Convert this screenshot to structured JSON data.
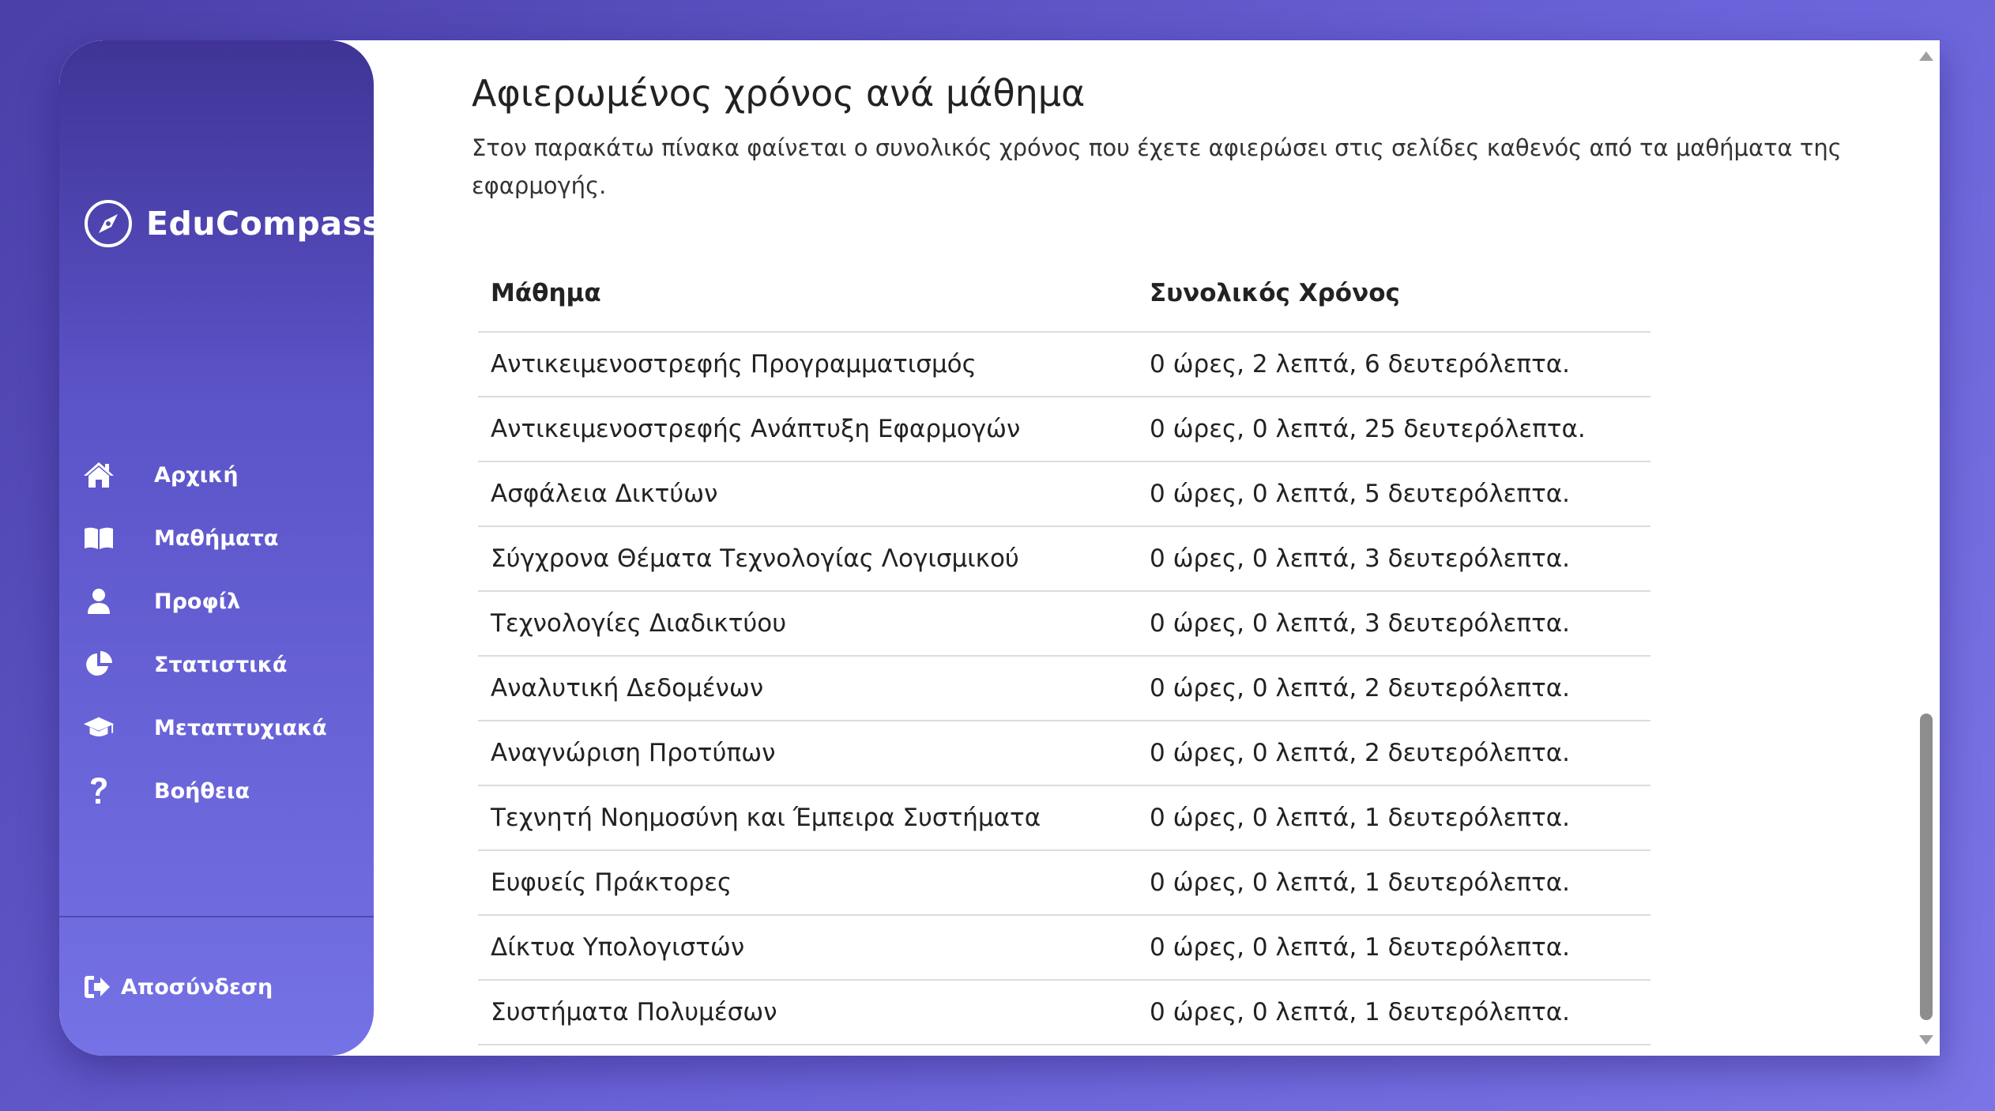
{
  "app": {
    "brand_name": "EduCompass",
    "logo_icon": "compass-icon"
  },
  "sidebar": {
    "items": [
      {
        "label": "Αρχική",
        "icon": "home-icon"
      },
      {
        "label": "Μαθήματα",
        "icon": "book-icon"
      },
      {
        "label": "Προφίλ",
        "icon": "user-icon"
      },
      {
        "label": "Στατιστικά",
        "icon": "pie-chart-icon"
      },
      {
        "label": "Μεταπτυχιακά",
        "icon": "graduation-cap-icon"
      },
      {
        "label": "Βοήθεια",
        "icon": "question-icon"
      }
    ],
    "logout": {
      "label": "Αποσύνδεση",
      "icon": "sign-out-icon"
    }
  },
  "main": {
    "title": "Αφιερωμένος χρόνος ανά μάθημα",
    "description": "Στον παρακάτω πίνακα φαίνεται ο συνολικός χρόνος που έχετε αφιερώσει στις σελίδες καθενός από τα μαθήματα της εφαρμογής.",
    "table": {
      "headers": [
        "Μάθημα",
        "Συνολικός Χρόνος"
      ],
      "rows": [
        [
          "Αντικειμενοστρεφής Προγραμματισμός",
          "0 ώρες, 2 λεπτά, 6 δευτερόλεπτα."
        ],
        [
          "Αντικειμενοστρεφής Ανάπτυξη Εφαρμογών",
          "0 ώρες, 0 λεπτά, 25 δευτερόλεπτα."
        ],
        [
          "Ασφάλεια Δικτύων",
          "0 ώρες, 0 λεπτά, 5 δευτερόλεπτα."
        ],
        [
          "Σύγχρονα Θέματα Τεχνολογίας Λογισμικού",
          "0 ώρες, 0 λεπτά, 3 δευτερόλεπτα."
        ],
        [
          "Τεχνολογίες Διαδικτύου",
          "0 ώρες, 0 λεπτά, 3 δευτερόλεπτα."
        ],
        [
          "Αναλυτική Δεδομένων",
          "0 ώρες, 0 λεπτά, 2 δευτερόλεπτα."
        ],
        [
          "Αναγνώριση Προτύπων",
          "0 ώρες, 0 λεπτά, 2 δευτερόλεπτα."
        ],
        [
          "Τεχνητή Νοημοσύνη και Έμπειρα Συστήματα",
          "0 ώρες, 0 λεπτά, 1 δευτερόλεπτα."
        ],
        [
          "Ευφυείς Πράκτορες",
          "0 ώρες, 0 λεπτά, 1 δευτερόλεπτα."
        ],
        [
          "Δίκτυα Υπολογιστών",
          "0 ώρες, 0 λεπτά, 1 δευτερόλεπτα."
        ],
        [
          "Συστήματα Πολυμέσων",
          "0 ώρες, 0 λεπτά, 1 δευτερόλεπτα."
        ]
      ]
    }
  },
  "colors": {
    "sidebar_top": "#3f3496",
    "sidebar_bottom": "#7572e6",
    "background": "#5a52c4",
    "text": "#222222"
  }
}
